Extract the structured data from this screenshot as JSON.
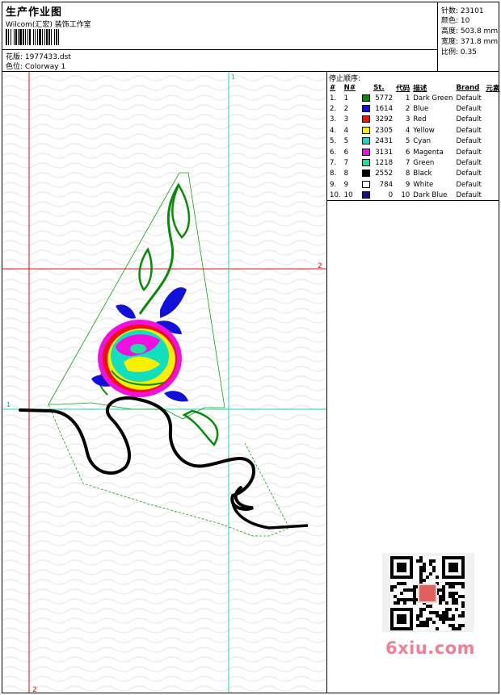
{
  "header": {
    "title": "生产作业图",
    "company": "Wilcom(汇宏) 装饰工作室",
    "design_label": "花版:",
    "design_value": "1977433.dst",
    "colorway_label": "色位:",
    "colorway_value": "Colorway 1"
  },
  "stats": [
    {
      "label": "针数:",
      "value": "23101"
    },
    {
      "label": "颜色:",
      "value": "10"
    },
    {
      "label": "高度:",
      "value": "503.8 mm"
    },
    {
      "label": "宽度:",
      "value": "371.8 mm"
    },
    {
      "label": "比例:",
      "value": "0.35"
    }
  ],
  "stop_sequence": {
    "title": "停止顺序:",
    "columns": [
      "#",
      "N#",
      "St.",
      "代码",
      "描述",
      "Brand",
      "元素"
    ],
    "rows": [
      {
        "idx": "1.",
        "n": "1",
        "color": "#0a8a0a",
        "st": "5772",
        "code": "1",
        "desc": "Dark Green",
        "brand": "Default"
      },
      {
        "idx": "2.",
        "n": "2",
        "color": "#1010e0",
        "st": "1614",
        "code": "2",
        "desc": "Blue",
        "brand": "Default"
      },
      {
        "idx": "3.",
        "n": "3",
        "color": "#f01010",
        "st": "3292",
        "code": "3",
        "desc": "Red",
        "brand": "Default"
      },
      {
        "idx": "4.",
        "n": "4",
        "color": "#f8f000",
        "st": "2305",
        "code": "4",
        "desc": "Yellow",
        "brand": "Default"
      },
      {
        "idx": "5.",
        "n": "5",
        "color": "#10e0c0",
        "st": "2431",
        "code": "5",
        "desc": "Cyan",
        "brand": "Default"
      },
      {
        "idx": "6.",
        "n": "6",
        "color": "#f010e0",
        "st": "3131",
        "code": "6",
        "desc": "Magenta",
        "brand": "Default"
      },
      {
        "idx": "7.",
        "n": "7",
        "color": "#20e0a0",
        "st": "1218",
        "code": "7",
        "desc": "Green",
        "brand": "Default"
      },
      {
        "idx": "8.",
        "n": "8",
        "color": "#000000",
        "st": "2552",
        "code": "8",
        "desc": "Black",
        "brand": "Default"
      },
      {
        "idx": "9.",
        "n": "9",
        "color": "#ffffff",
        "st": "784",
        "code": "9",
        "desc": "White",
        "brand": "Default"
      },
      {
        "idx": "10.",
        "n": "10",
        "color": "#101090",
        "st": "0",
        "code": "10",
        "desc": "Dark Blue",
        "brand": "Default"
      }
    ]
  },
  "canvas": {
    "guide_labels": {
      "red_vertical": "2",
      "red_horizontal": "2",
      "cyan_vertical": "1",
      "cyan_horizontal": "1"
    }
  },
  "watermark": "6xiu.com"
}
